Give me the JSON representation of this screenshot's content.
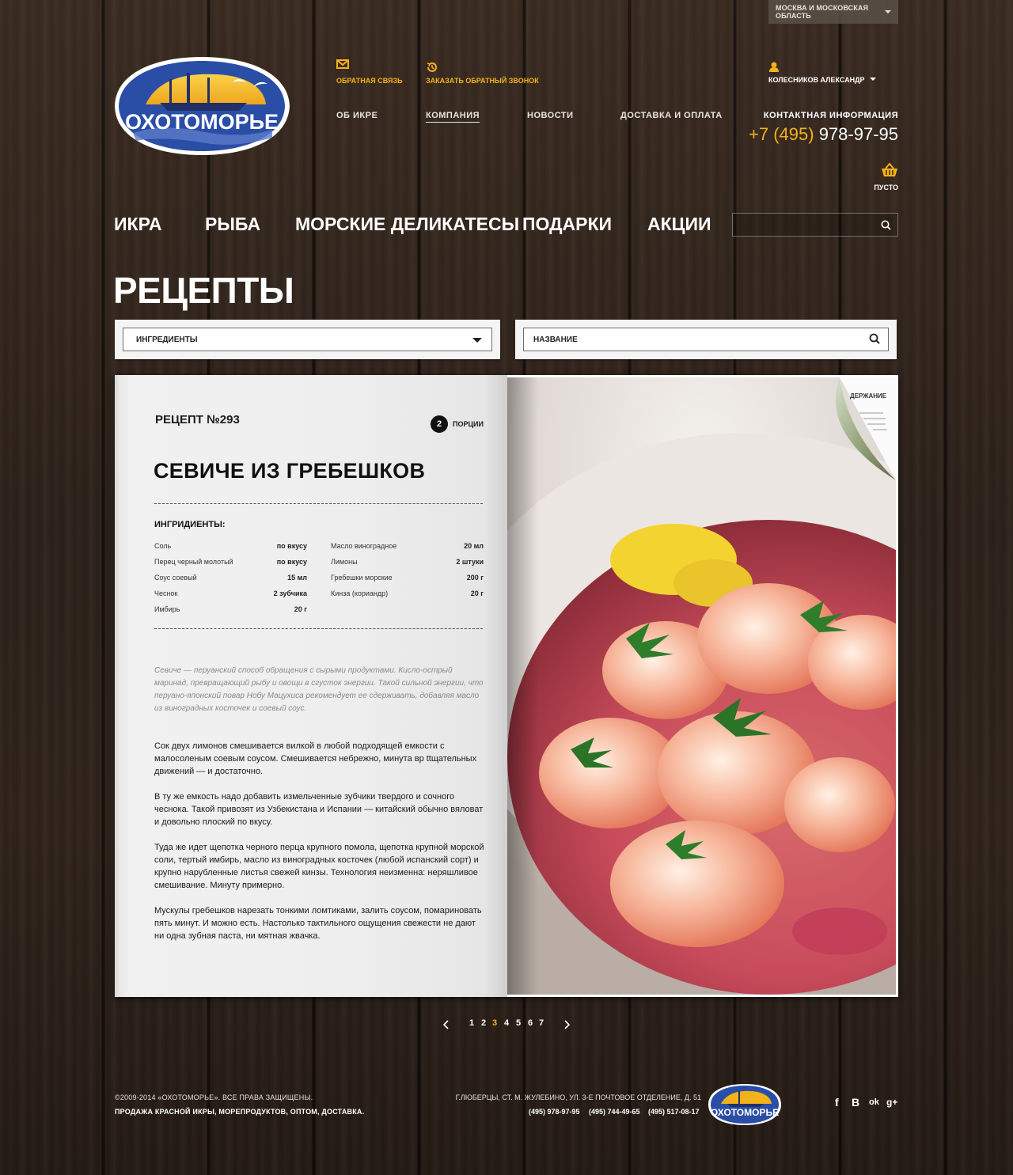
{
  "region": {
    "label": "МОСКВА И МОСКОВСКАЯ ОБЛАСТЬ"
  },
  "brand": {
    "name": "ОХОТОМОРЬЕ"
  },
  "top_links": {
    "feedback": "ОБРАТНАЯ СВЯЗЬ",
    "callback": "ЗАКАЗАТЬ ОБРАТНЫЙ ЗВОНОК"
  },
  "main_nav": [
    "ОБ ИКРЕ",
    "КОМПАНИЯ",
    "НОВОСТИ",
    "ДОСТАВКА И ОПЛАТА"
  ],
  "user": {
    "name": "КОЛЕСНИКОВ АЛЕКСАНДР"
  },
  "contact": {
    "label": "КОНТАКТНАЯ ИНФОРМАЦИЯ",
    "phone_code": "+7 (495)",
    "phone_number": "978-97-95"
  },
  "cart": {
    "status": "ПУСТО"
  },
  "categories": [
    "ИКРА",
    "РЫБА",
    "МОРСКИЕ ДЕЛИКАТЕСЫ",
    "ПОДАРКИ",
    "АКЦИИ"
  ],
  "page": {
    "title": "РЕЦЕПТЫ"
  },
  "filters": {
    "ingredients": "ИНГРЕДИЕНТЫ",
    "name": "НАЗВАНИЕ"
  },
  "recipe": {
    "number": "РЕЦЕПТ №293",
    "portions_count": "2",
    "portions_label": "ПОРЦИИ",
    "title": "СЕВИЧЕ ИЗ ГРЕБЕШКОВ",
    "ingredients_heading": "ИНГРИДИЕНТЫ:",
    "ingredients_left": [
      {
        "name": "Соль",
        "qty": "по вкусу"
      },
      {
        "name": "Перец черный молотый",
        "qty": "по вкусу"
      },
      {
        "name": "Соус соевый",
        "qty": "15 мл"
      },
      {
        "name": "Чеснок",
        "qty": "2 зубчика"
      },
      {
        "name": "Имбирь",
        "qty": "20 г"
      }
    ],
    "ingredients_right": [
      {
        "name": "Масло виноградное",
        "qty": "20 мл"
      },
      {
        "name": "Лимоны",
        "qty": "2 штуки"
      },
      {
        "name": "Гребешки морские",
        "qty": "200 г"
      },
      {
        "name": "Кинза (кориандр)",
        "qty": "20 г"
      }
    ],
    "intro": "Севиче — перуанский способ обращения с сырыми продуктами. Кисло-острый маринад, превращающий рыбу и овощи в сгусток энергии. Такой сильной энергии, что перуано-японский повар Нобу Мацухиса рекомендует ее сдерживать, добавляя масло из виноградных косточек и соевый соус.",
    "paragraphs": [
      "Сок двух лимонов смешивается вилкой в любой подходящей емкости с малосоленым соевым соусом. Смешивается небрежно, минута вр ttщательных движений — и достаточно.",
      "В ту же емкость надо добавить измельченные зубчики твердого и сочного чеснока. Такой привозят из Узбекистана и Испании — китайский обычно вяловат и довольно плоский по вкусу.",
      "Туда же идет щепотка черного перца крупного помола, щепотка крупной морской соли, тертый имбирь, масло из виноградных косточек (любой испанский сорт) и крупно нарубленные листья свежей кинзы. Технология неизменна: неряшливое смешивание. Минуту примерно.",
      "Мускулы гребешков нарезать тонкими ломтиками, залить соусом, помариновать пять минут. И можно есть. Настолько тактильного ощущения свежести не дают ни одна зубная паста, ни мятная жвачка."
    ],
    "corner_label": "ДЕРЖАНИЕ"
  },
  "pagination": {
    "pages": [
      "1",
      "2",
      "3",
      "4",
      "5",
      "6",
      "7"
    ],
    "current": "3",
    "prev": "‹",
    "next": "›"
  },
  "footer": {
    "copyright": "©2009-2014 «ОХОТОМОРЬЕ». ВСЕ ПРАВА ЗАЩИЩЕНЫ.",
    "tagline": "ПРОДАЖА КРАСНОЙ ИКРЫ, МОРЕПРОДУКТОВ, ОПТОМ, ДОСТАВКА.",
    "address": "Г.ЛЮБЕРЦЫ, СТ. М. ЖУЛЕБИНО, УЛ. 3-Е ПОЧТОВОЕ ОТДЕЛЕНИЕ, Д. 51",
    "phones": [
      "(495) 978-97-95",
      "(495) 744-49-65",
      "(495) 517-08-17"
    ],
    "social": [
      "f",
      "B",
      "ok",
      "g+"
    ]
  },
  "colors": {
    "accent": "#f2b21a",
    "logo_blue": "#1f3d8f",
    "logo_yellow": "#f5c531"
  },
  "icons": [
    "envelope-icon",
    "history-icon",
    "user-icon",
    "basket-icon",
    "search-icon",
    "chevron-down-icon",
    "chevron-left-icon",
    "chevron-right-icon",
    "facebook-icon",
    "vk-icon",
    "odnoklassniki-icon",
    "google-plus-icon"
  ]
}
